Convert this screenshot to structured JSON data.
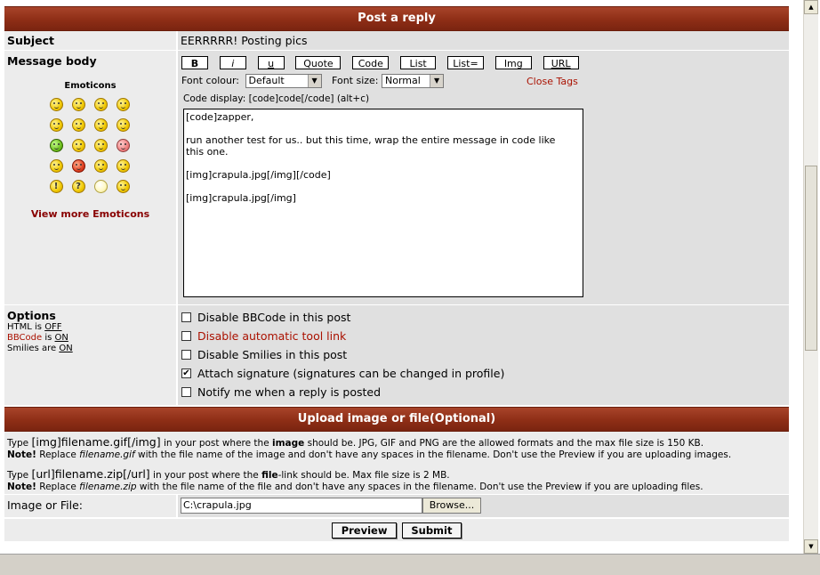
{
  "header": {
    "title": "Post a reply"
  },
  "subject": {
    "label": "Subject",
    "value": "EERRRRR! Posting pics"
  },
  "message": {
    "label": "Message body",
    "emoticons_title": "Emoticons",
    "view_more": "View more Emoticons",
    "buttons": [
      "B",
      "i",
      "u",
      "Quote",
      "Code",
      "List",
      "List=",
      "Img",
      "URL"
    ],
    "font_colour_label": "Font colour:",
    "font_colour_value": "Default",
    "font_size_label": "Font size:",
    "font_size_value": "Normal",
    "close_tags": "Close Tags",
    "help_line": "Code display: [code]code[/code]  (alt+c)",
    "body": "[code]zapper,\n\nrun another test for us.. but this time, wrap the entire message in code like\nthis one.\n\n[img]crapula.jpg[/img][/code]\n\n[img]crapula.jpg[/img]"
  },
  "options": {
    "label": "Options",
    "html_status": {
      "prefix": "HTML is ",
      "value": "OFF"
    },
    "bbcode_status": {
      "prefix": "BBCode",
      "mid": " is ",
      "value": "ON"
    },
    "smilies_status": {
      "prefix": "Smilies are ",
      "value": "ON"
    },
    "items": [
      {
        "label": "Disable BBCode in this post",
        "checked": false
      },
      {
        "label": "Disable automatic tool link",
        "checked": false
      },
      {
        "label": "Disable Smilies in this post",
        "checked": false
      },
      {
        "label": "Attach signature (signatures can be changed in profile)",
        "checked": true
      },
      {
        "label": "Notify me when a reply is posted",
        "checked": false
      }
    ]
  },
  "upload": {
    "title": "Upload image or file(Optional)",
    "line1_pre": "Type ",
    "line1_code": "[img]filename.gif[/img]",
    "line1_mid": " in your post where the ",
    "line1_bold": "image",
    "line1_post": " should be. JPG, GIF and PNG are the allowed formats and the max file size is 150 KB.",
    "note_label": "Note!",
    "note1_pre": " Replace ",
    "note1_file": "filename.gif",
    "note1_post": " with the file name of the image and don't have any spaces in the filename. Don't use the Preview if you are uploading images.",
    "line2_pre": "Type ",
    "line2_code": "[url]filename.zip[/url]",
    "line2_mid": " in your post where the ",
    "line2_bold": "file",
    "line2_post": "-link should be. Max file size is 2 MB.",
    "note2_pre": " Replace ",
    "note2_file": "filename.zip",
    "note2_post": " with the file name of the file and don't have any spaces in the filename. Don't use the Preview if you are uploading files.",
    "file_label": "Image or File:",
    "file_value": "C:\\crapula.jpg",
    "browse": "Browse..."
  },
  "actions": {
    "preview": "Preview",
    "submit": "Submit"
  },
  "colors": {
    "header": "#8e2e16",
    "red_text": "#aa1100"
  }
}
